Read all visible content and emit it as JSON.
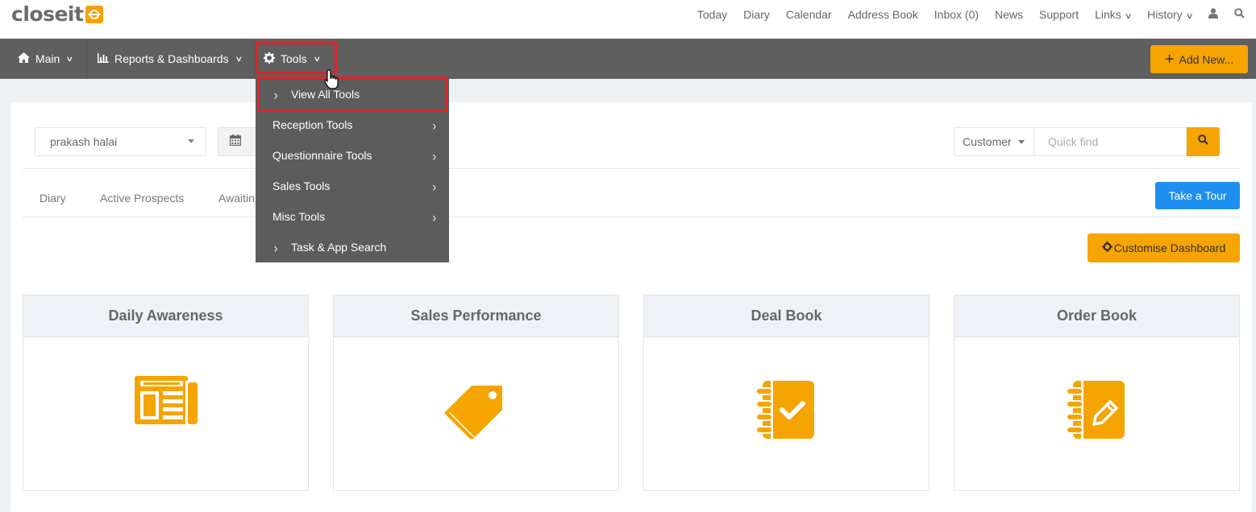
{
  "app": {
    "logo_text": "closeit"
  },
  "top_nav": {
    "links": [
      "Today",
      "Diary",
      "Calendar",
      "Address Book",
      "Inbox (0)",
      "News",
      "Support"
    ],
    "links_dropdown": "Links",
    "history_dropdown": "History",
    "user_icon": "user-icon",
    "search_icon": "search-icon"
  },
  "nav": {
    "main": "Main",
    "reports": "Reports & Dashboards",
    "tools": "Tools",
    "add_new": "Add New..."
  },
  "tools_menu": {
    "items": [
      {
        "label": "View All Tools",
        "submenu": false,
        "highlighted": true
      },
      {
        "label": "Reception Tools",
        "submenu": true
      },
      {
        "label": "Questionnaire Tools",
        "submenu": true
      },
      {
        "label": "Sales Tools",
        "submenu": true
      },
      {
        "label": "Misc Tools",
        "submenu": true
      },
      {
        "label": "Task & App Search",
        "submenu": false
      }
    ]
  },
  "filters": {
    "user": "prakash halai",
    "customer_select": "Customer",
    "quick_find_placeholder": "Quick find"
  },
  "tabs": [
    "Diary",
    "Active Prospects",
    "Awaitin"
  ],
  "buttons": {
    "take_tour": "Take a Tour",
    "customise_dashboard": "Customise Dashboard"
  },
  "cards": [
    {
      "title": "Daily Awareness",
      "icon": "newspaper-icon"
    },
    {
      "title": "Sales Performance",
      "icon": "tags-icon"
    },
    {
      "title": "Deal Book",
      "icon": "notebook-check-icon"
    },
    {
      "title": "Order Book",
      "icon": "notebook-pencil-icon"
    }
  ],
  "colors": {
    "accent": "#f5a400",
    "nav_bg": "#5f5f5f",
    "tour_blue": "#1e8ff0",
    "highlight_red": "#e3222a"
  }
}
